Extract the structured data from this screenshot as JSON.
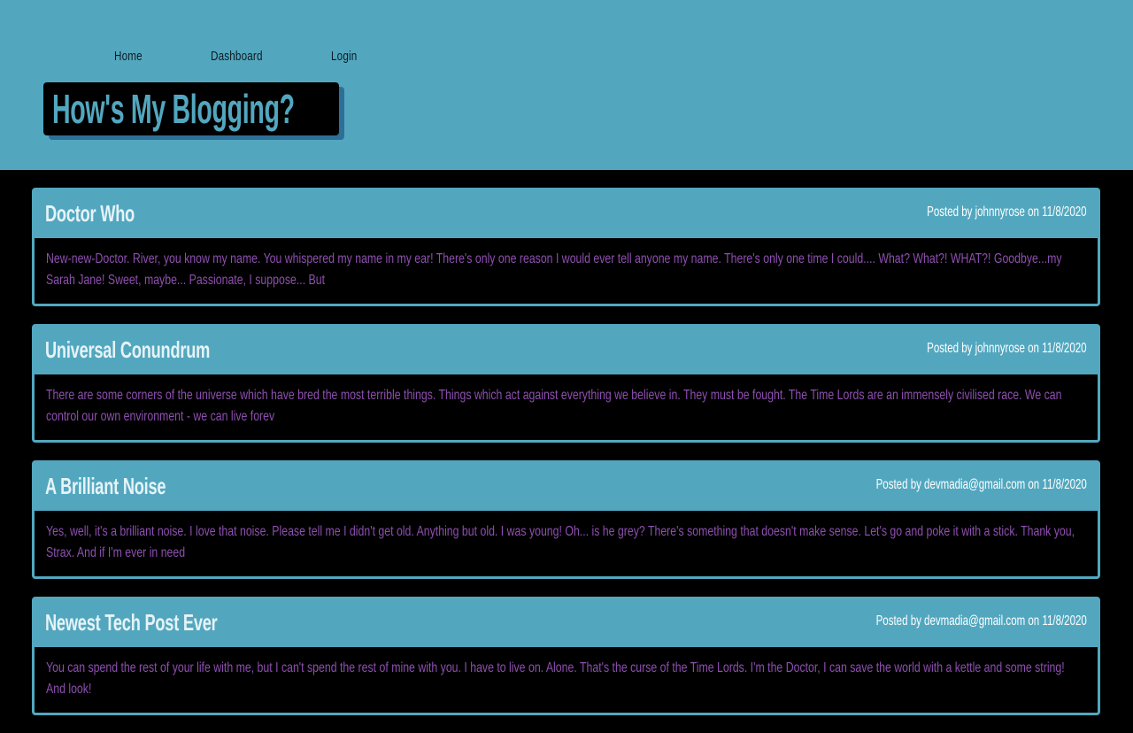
{
  "nav": {
    "home": "Home",
    "dashboard": "Dashboard",
    "login": "Login"
  },
  "site": {
    "title": "How's My Blogging?"
  },
  "colors": {
    "accent": "#52a7bf",
    "background": "#000000",
    "body_text": "#8e4fb0",
    "title_text": "#e6f3f7"
  },
  "posts": [
    {
      "title": "Doctor Who",
      "meta": "Posted by johnnyrose on 11/8/2020",
      "content": "New-new-Doctor. River, you know my name. You whispered my name in my ear! There's only one reason I would ever tell anyone my name. There's only one time I could.... What? What?! WHAT?! Goodbye...my Sarah Jane! Sweet, maybe... Passionate, I suppose... But"
    },
    {
      "title": "Universal Conundrum",
      "meta": "Posted by johnnyrose on 11/8/2020",
      "content": "There are some corners of the universe which have bred the most terrible things. Things which act against everything we believe in. They must be fought. The Time Lords are an immensely civilised race. We can control our own environment - we can live forev"
    },
    {
      "title": "A Brilliant Noise",
      "meta": "Posted by devmadia@gmail.com on 11/8/2020",
      "content": "Yes, well, it's a brilliant noise. I love that noise. Please tell me I didn't get old. Anything but old. I was young! Oh... is he grey? There's something that doesn't make sense. Let's go and poke it with a stick. Thank you, Strax. And if I'm ever in need"
    },
    {
      "title": "Newest Tech Post Ever",
      "meta": "Posted by devmadia@gmail.com on 11/8/2020",
      "content": "You can spend the rest of your life with me, but I can't spend the rest of mine with you. I have to live on. Alone. That's the curse of the Time Lords. I'm the Doctor, I can save the world with a kettle and some string! And look!"
    }
  ]
}
